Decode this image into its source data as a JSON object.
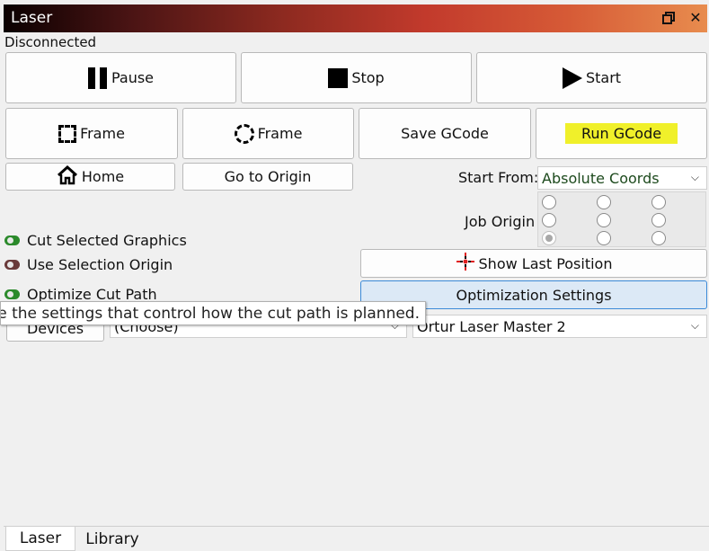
{
  "window": {
    "title": "Laser"
  },
  "status": "Disconnected",
  "controls": {
    "pause": "Pause",
    "stop": "Stop",
    "start": "Start"
  },
  "frame": {
    "rect_label": "Frame",
    "circle_label": "Frame"
  },
  "gcode": {
    "save": "Save GCode",
    "run": "Run GCode"
  },
  "nav": {
    "home": "Home",
    "origin": "Go to Origin"
  },
  "start_from": {
    "label": "Start From:",
    "value": "Absolute Coords"
  },
  "job_origin": {
    "label": "Job Origin",
    "selected": "bottom-left"
  },
  "options": {
    "cut_selected": {
      "label": "Cut Selected Graphics",
      "on": true
    },
    "selection_origin": {
      "label": "Use Selection Origin",
      "on": false
    },
    "optimize": {
      "label": "Optimize Cut Path",
      "on": true
    }
  },
  "show_last_position": "Show Last Position",
  "optimization_settings": "Optimization Settings",
  "devices": {
    "button": "Devices",
    "port": "(Choose)",
    "profile": "Ortur Laser Master 2"
  },
  "tooltip": "ge the settings that control how the cut path is planned.",
  "tabs": [
    "Laser",
    "Library"
  ],
  "colors": {
    "highlight": "#f0f02a",
    "toggle_on": "#2b8a2b",
    "toggle_off": "#6a3a3a",
    "accent_border": "#3b8ad8"
  }
}
